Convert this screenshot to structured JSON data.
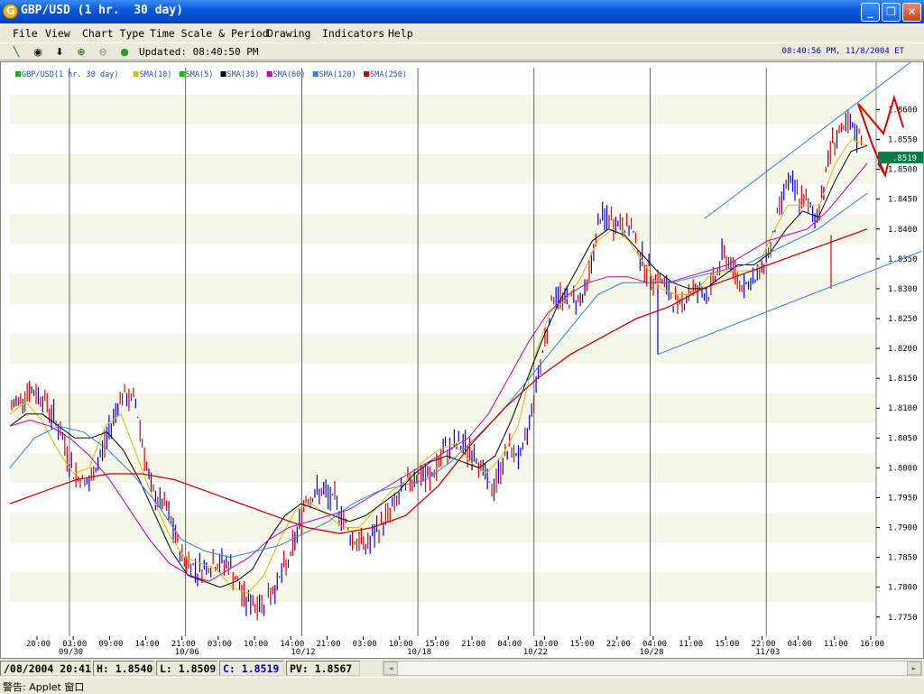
{
  "window": {
    "title": "GBP/USD (1 hr.  30 day)",
    "minimize_label": "_",
    "maximize_label": "❐",
    "close_label": "✕"
  },
  "menu": [
    "File",
    "View",
    "Chart Type",
    "Time Scale & Period",
    "Drawing",
    "Indicators",
    "Help"
  ],
  "toolbar": {
    "tools": [
      {
        "name": "trendline-tool-icon",
        "glyph": "╲"
      },
      {
        "name": "crosshair-tool-icon",
        "glyph": "◉"
      },
      {
        "name": "down-arrow-tool-icon",
        "glyph": "⬇"
      },
      {
        "name": "zoom-in-icon",
        "glyph": "⊕"
      },
      {
        "name": "zoom-out-icon",
        "glyph": "⊖"
      },
      {
        "name": "refresh-icon",
        "glyph": "●"
      }
    ],
    "updated": "Updated: 08:40:50 PM",
    "datetime": "08:40:56 PM, 11/8/2004 ET"
  },
  "legend": [
    {
      "label": "GBP/USD(1 hr.  30 day)",
      "color": "#00C000"
    },
    {
      "label": "SMA(10)",
      "color": "#D4C000"
    },
    {
      "label": "SMA(5)",
      "color": "#00C000"
    },
    {
      "label": "SMA(30)",
      "color": "#000000"
    },
    {
      "label": "SMA(60)",
      "color": "#C000C0"
    },
    {
      "label": "SMA(120)",
      "color": "#3080E0"
    },
    {
      "label": "SMA(250)",
      "color": "#D00000"
    }
  ],
  "chart_data": {
    "type": "line",
    "ylim": [
      1.773,
      1.864
    ],
    "y_ticks": [
      "1.8600",
      "1.8550",
      "1.8500",
      "1.8450",
      "1.8400",
      "1.8350",
      "1.8300",
      "1.8250",
      "1.8200",
      "1.8150",
      "1.8100",
      "1.8050",
      "1.8000",
      "1.7950",
      "1.7900",
      "1.7850",
      "1.7800",
      "1.7750"
    ],
    "current_price": ".8519",
    "x_tick_labels": [
      "20:00",
      "03:00",
      "09:00",
      "14:00",
      "21:00",
      "03:00",
      "10:00",
      "14:00",
      "21:00",
      "03:00",
      "10:00",
      "15:00",
      "21:00",
      "04:00",
      "10:00",
      "15:00",
      "22:00",
      "04:00",
      "11:00",
      "15:00",
      "22:00",
      "04:00",
      "11:00",
      "16:00"
    ],
    "date_labels": [
      "09/30",
      "10/06",
      "10/12",
      "10/18",
      "10/22",
      "10/28",
      "11/03"
    ],
    "price_path": [
      1.81,
      1.813,
      1.812,
      1.807,
      1.799,
      1.797,
      1.804,
      1.812,
      1.811,
      1.796,
      1.793,
      1.785,
      1.783,
      1.784,
      1.784,
      1.778,
      1.777,
      1.78,
      1.785,
      1.795,
      1.796,
      1.794,
      1.788,
      1.787,
      1.791,
      1.795,
      1.799,
      1.798,
      1.803,
      1.804,
      1.802,
      1.796,
      1.803,
      1.802,
      1.816,
      1.829,
      1.828,
      1.829,
      1.842,
      1.841,
      1.84,
      1.833,
      1.831,
      1.827,
      1.83,
      1.829,
      1.836,
      1.831,
      1.831,
      1.837,
      1.848,
      1.845,
      1.842,
      1.855,
      1.857,
      1.855
    ],
    "sma": [
      {
        "name": "SMA(10)",
        "color": "#D4C000",
        "values": [
          1.809,
          1.811,
          1.808,
          1.803,
          1.799,
          1.8,
          1.807,
          1.809,
          1.802,
          1.795,
          1.789,
          1.785,
          1.784,
          1.783,
          1.78,
          1.779,
          1.782,
          1.788,
          1.793,
          1.794,
          1.792,
          1.79,
          1.79,
          1.793,
          1.796,
          1.798,
          1.801,
          1.803,
          1.804,
          1.801,
          1.799,
          1.802,
          1.807,
          1.818,
          1.826,
          1.828,
          1.832,
          1.838,
          1.84,
          1.838,
          1.834,
          1.83,
          1.829,
          1.829,
          1.832,
          1.833,
          1.833,
          1.833,
          1.839,
          1.844,
          1.844,
          1.844,
          1.851,
          1.855,
          1.854
        ]
      },
      {
        "name": "SMA(30)",
        "color": "#000000",
        "values": [
          1.807,
          1.809,
          1.809,
          1.807,
          1.805,
          1.805,
          1.806,
          1.803,
          1.798,
          1.792,
          1.786,
          1.782,
          1.781,
          1.78,
          1.781,
          1.783,
          1.788,
          1.792,
          1.794,
          1.793,
          1.792,
          1.791,
          1.792,
          1.794,
          1.796,
          1.799,
          1.801,
          1.802,
          1.801,
          1.8,
          1.802,
          1.808,
          1.815,
          1.822,
          1.828,
          1.833,
          1.838,
          1.84,
          1.839,
          1.836,
          1.833,
          1.831,
          1.83,
          1.83,
          1.832,
          1.834,
          1.834,
          1.836,
          1.84,
          1.843,
          1.842,
          1.848,
          1.853,
          1.854
        ]
      },
      {
        "name": "SMA(60)",
        "color": "#C000C0",
        "values": [
          1.807,
          1.808,
          1.807,
          1.805,
          1.802,
          1.798,
          1.793,
          1.788,
          1.784,
          1.782,
          1.781,
          1.783,
          1.785,
          1.788,
          1.79,
          1.791,
          1.792,
          1.793,
          1.795,
          1.797,
          1.799,
          1.801,
          1.803,
          1.805,
          1.809,
          1.815,
          1.821,
          1.826,
          1.829,
          1.831,
          1.832,
          1.832,
          1.831,
          1.831,
          1.832,
          1.833,
          1.834,
          1.836,
          1.838,
          1.839,
          1.84,
          1.843,
          1.847,
          1.851
        ]
      },
      {
        "name": "SMA(120)",
        "color": "#3080E0",
        "values": [
          1.8,
          1.805,
          1.807,
          1.806,
          1.803,
          1.799,
          1.794,
          1.788,
          1.786,
          1.785,
          1.786,
          1.787,
          1.789,
          1.791,
          1.794,
          1.796,
          1.797,
          1.798,
          1.801,
          1.805,
          1.809,
          1.814,
          1.819,
          1.824,
          1.829,
          1.831,
          1.831,
          1.831,
          1.832,
          1.833,
          1.834,
          1.836,
          1.838,
          1.84,
          1.843,
          1.846
        ]
      },
      {
        "name": "SMA(250)",
        "color": "#D00000",
        "values": [
          1.794,
          1.796,
          1.798,
          1.799,
          1.799,
          1.798,
          1.796,
          1.794,
          1.792,
          1.79,
          1.789,
          1.79,
          1.792,
          1.797,
          1.804,
          1.81,
          1.815,
          1.819,
          1.822,
          1.825,
          1.827,
          1.83,
          1.832,
          1.834,
          1.836,
          1.838,
          1.84
        ]
      }
    ],
    "trend_channel": {
      "upper": [
        1.841,
        1.864
      ],
      "lower": [
        1.819,
        1.834
      ]
    },
    "drawn_arrows": [
      [
        1.861,
        1.851
      ],
      [
        1.851,
        1.86
      ],
      [
        1.855,
        1.849
      ]
    ]
  },
  "status": {
    "date": "/08/2004 20:41",
    "high": "H: 1.8540",
    "low": "L: 1.8509",
    "close": "C: 1.8519",
    "pv": "PV: 1.8567",
    "scroll_left": "◄",
    "scroll_right": "►"
  },
  "applet_warning": "警告: Applet 窗口"
}
